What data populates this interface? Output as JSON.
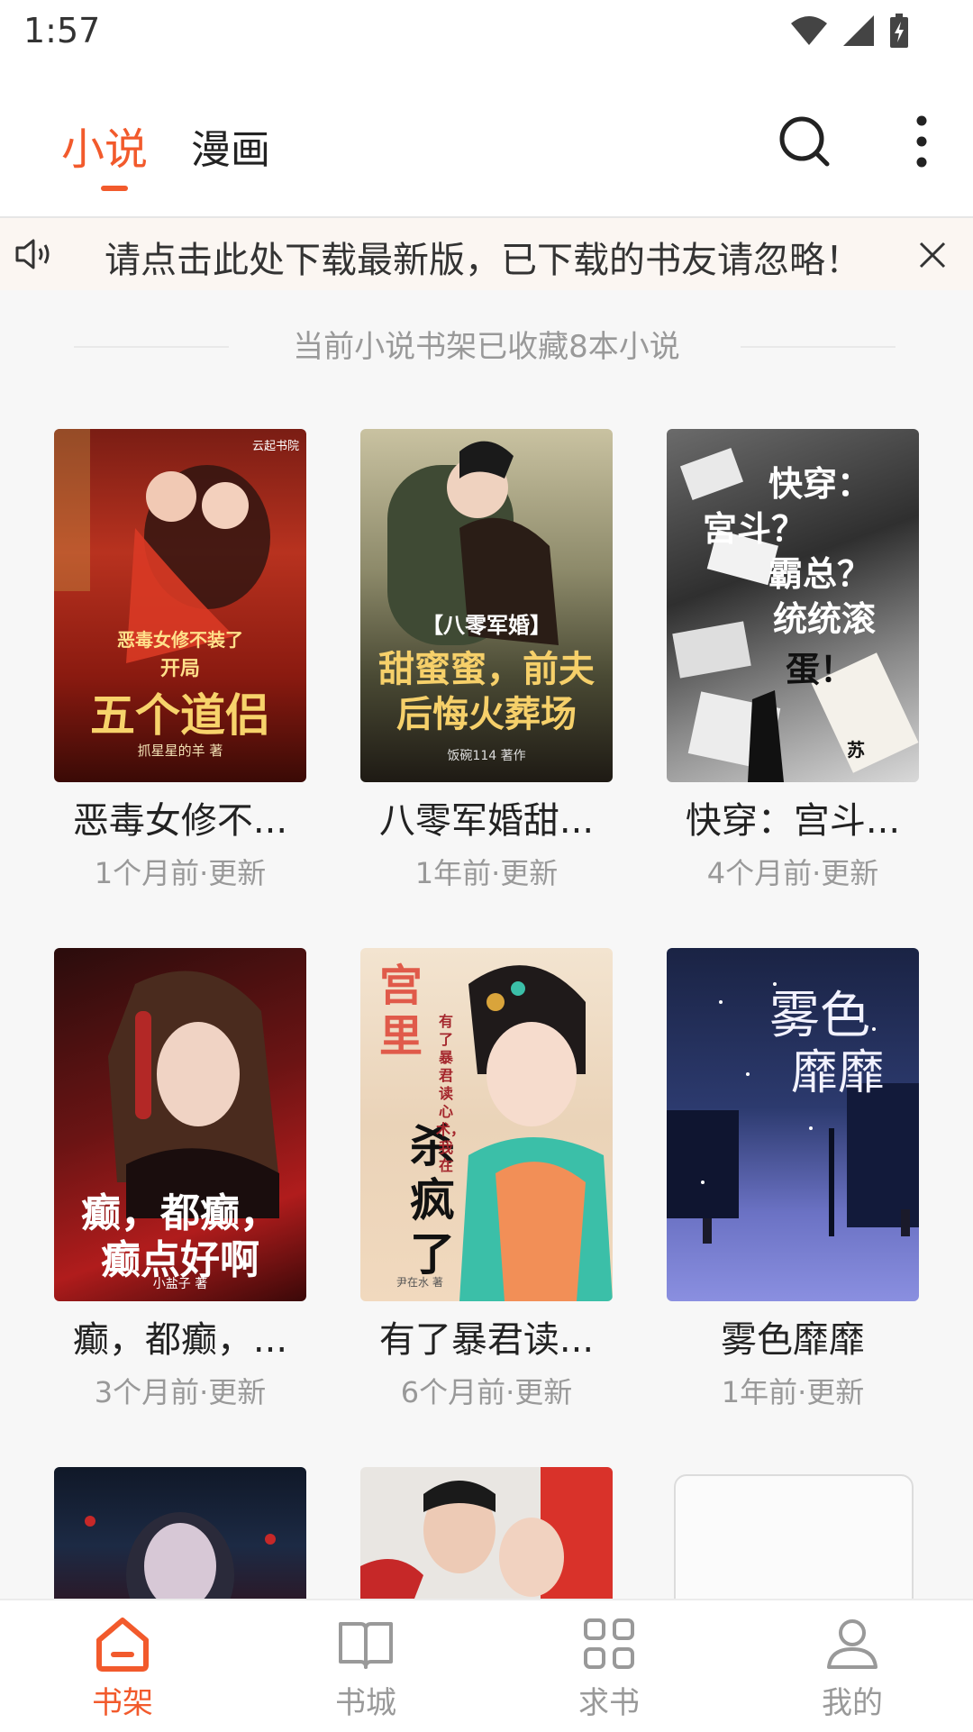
{
  "status": {
    "time": "1:57"
  },
  "header": {
    "tabs": [
      {
        "label": "小说",
        "active": true
      },
      {
        "label": "漫画",
        "active": false
      }
    ],
    "search_icon": "search-icon",
    "more_icon": "more-vertical-icon",
    "accent_color": "#f25a2c"
  },
  "notice": {
    "text": "请点击此处下载最新版，已下载的书友请忽略！",
    "icon": "speaker-icon",
    "close_icon": "close-icon"
  },
  "shelf": {
    "summary": "当前小说书架已收藏8本小说"
  },
  "books": [
    {
      "title": "恶毒女修不...",
      "updated": "1个月前·更新",
      "cover_texts": [
        "恶毒女修不装了",
        "开局",
        "五个道侣",
        "抓星星的羊 著",
        "云起书院"
      ]
    },
    {
      "title": "八零军婚甜...",
      "updated": "1年前·更新",
      "cover_texts": [
        "【八零军婚】",
        "甜蜜蜜，前夫",
        "后悔火葬场",
        "饭碗114 著作"
      ]
    },
    {
      "title": "快穿：宫斗...",
      "updated": "4个月前·更新",
      "cover_texts": [
        "快穿：",
        "宫斗？",
        "霸总？",
        "统统滚",
        "蛋！",
        "苏"
      ]
    },
    {
      "title": "癫，都癫，...",
      "updated": "3个月前·更新",
      "cover_texts": [
        "癫，都癫，",
        "癫点好啊",
        "小盐子 著"
      ]
    },
    {
      "title": "有了暴君读...",
      "updated": "6个月前·更新",
      "cover_texts": [
        "宫里",
        "杀疯了",
        "有了暴君读心术，我在",
        "尹在水 著"
      ]
    },
    {
      "title": "雾色靡靡",
      "updated": "1年前·更新",
      "cover_texts": [
        "雾色",
        "靡靡"
      ]
    }
  ],
  "bottom_nav": [
    {
      "label": "书架",
      "icon": "home-icon",
      "active": true
    },
    {
      "label": "书城",
      "icon": "book-open-icon",
      "active": false
    },
    {
      "label": "求书",
      "icon": "grid-icon",
      "active": false
    },
    {
      "label": "我的",
      "icon": "user-icon",
      "active": false
    }
  ]
}
